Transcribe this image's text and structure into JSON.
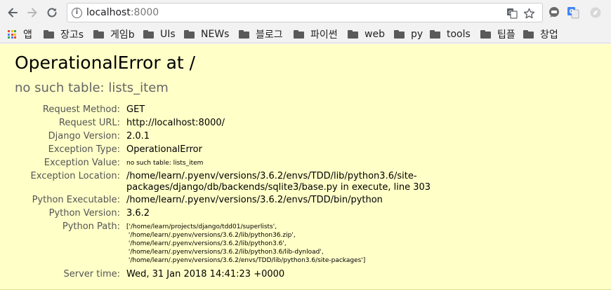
{
  "browser": {
    "url_host": "localhost",
    "url_port": ":8000",
    "bookmarks": [
      {
        "label": "앱",
        "icon": "apps-grid-icon"
      },
      {
        "label": "장고s",
        "icon": "folder-icon"
      },
      {
        "label": "게임b",
        "icon": "folder-icon"
      },
      {
        "label": "UIs",
        "icon": "folder-icon"
      },
      {
        "label": "NEWs",
        "icon": "folder-icon"
      },
      {
        "label": "블로그",
        "icon": "folder-icon"
      },
      {
        "label": "파이썬",
        "icon": "folder-icon"
      },
      {
        "label": "web",
        "icon": "folder-icon"
      },
      {
        "label": "py",
        "icon": "folder-icon"
      },
      {
        "label": "tools",
        "icon": "folder-icon"
      },
      {
        "label": "팁플",
        "icon": "folder-icon"
      },
      {
        "label": "창업",
        "icon": "folder-icon"
      }
    ]
  },
  "error": {
    "title": "OperationalError at /",
    "message": "no such table: lists_item",
    "rows": [
      {
        "label": "Request Method:",
        "value": "GET"
      },
      {
        "label": "Request URL:",
        "value": "http://localhost:8000/"
      },
      {
        "label": "Django Version:",
        "value": "2.0.1"
      },
      {
        "label": "Exception Type:",
        "value": "OperationalError"
      },
      {
        "label": "Exception Value:",
        "value": "no such table: lists_item"
      },
      {
        "label": "Exception Location:",
        "value": "/home/learn/.pyenv/versions/3.6.2/envs/TDD/lib/python3.6/site-packages/django/db/backends/sqlite3/base.py in execute, line 303"
      },
      {
        "label": "Python Executable:",
        "value": "/home/learn/.pyenv/versions/3.6.2/envs/TDD/bin/python"
      },
      {
        "label": "Python Version:",
        "value": "3.6.2"
      },
      {
        "label": "Python Path:",
        "value": "['/home/learn/projects/django/tdd01/superlists',\n '/home/learn/.pyenv/versions/3.6.2/lib/python36.zip',\n '/home/learn/.pyenv/versions/3.6.2/lib/python3.6',\n '/home/learn/.pyenv/versions/3.6.2/lib/python3.6/lib-dynload',\n '/home/learn/.pyenv/versions/3.6.2/envs/TDD/lib/python3.6/site-packages']"
      },
      {
        "label": "Server time:",
        "value": "Wed, 31 Jan 2018 14:41:23 +0000"
      }
    ]
  },
  "colors": {
    "page_bg": "#ffffc8",
    "label": "#555555",
    "subtitle": "#666666",
    "chrome_bg": "#f2f2f2"
  }
}
